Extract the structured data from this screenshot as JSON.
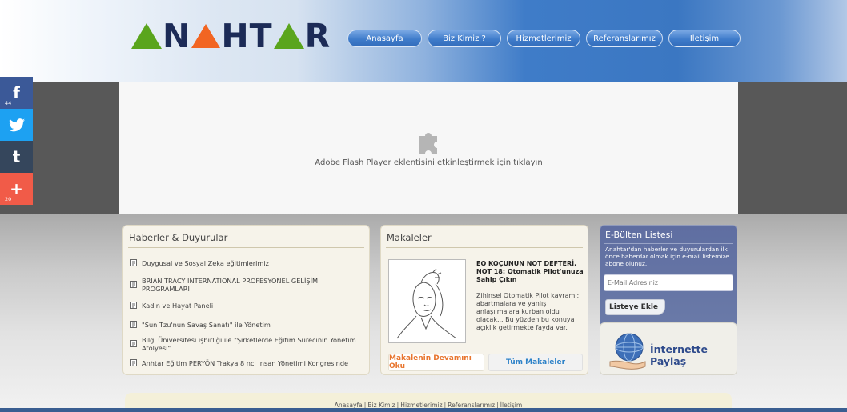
{
  "header": {
    "logo_text": "ANAHTAR",
    "nav": [
      "Anasayfa",
      "Biz Kimiz ?",
      "Hizmetlerimiz",
      "Referanslarımız",
      "İletişim"
    ]
  },
  "social": {
    "facebook_count": "44",
    "addthis_count": "20"
  },
  "flash": {
    "message": "Adobe Flash Player eklentisini etkinleştirmek için tıklayın"
  },
  "news": {
    "title": "Haberler & Duyurular",
    "items": [
      "Duygusal ve Sosyal Zeka eğitimlerimiz",
      "BRIAN TRACY INTERNATIONAL PROFESYONEL GELİŞİM PROGRAMLARI",
      "Kadın ve Hayat Paneli",
      "\"Sun Tzu'nun Savaş Sanatı\" ile Yönetim",
      "Bilgi Üniversitesi işbirliği ile \"Şirketlerde Eğitim Sürecinin Yönetim Atölyesi\"",
      "Anhtar Eğitim PERYÖN Trakya 8 nci İnsan Yönetimi Kongresinde"
    ]
  },
  "articles": {
    "title": "Makaleler",
    "article_title": "EQ KOÇUNUN NOT DEFTERİ, NOT 18: Otomatik Pilot'unuza Sahip Çıkın",
    "article_body": "Zihinsel Otomatik Pilot kavramı; abartmalara ve yanlış anlaşılmalara kurban oldu olacak... Bu yüzden bu konuya açıklık getirmekte fayda var.",
    "read_more": "Makalenin Devamını Oku",
    "all_articles": "Tüm Makaleler"
  },
  "newsletter": {
    "title": "E-Bülten Listesi",
    "text": "Anahtar'dan haberler ve duyurulardan ilk önce haberdar olmak için e-mail listemize abone olunuz.",
    "placeholder": "E-Mail Adresiniz",
    "button": "Listeye Ekle"
  },
  "share": {
    "label": "İnternette Paylaş"
  },
  "footer": {
    "links": [
      "Anasayfa",
      "Biz Kimiz",
      "Hizmetlerimiz",
      "Referanslarımız",
      "İletişim"
    ]
  },
  "colors": {
    "logo_navy": "#1c2b57",
    "logo_orange": "#f26522",
    "logo_green": "#5aa51d",
    "nav_blue": "#3f7ccb",
    "newsletter_bg": "#5f6ea1",
    "read_more": "#e8762f",
    "all_articles": "#2d82c8"
  }
}
